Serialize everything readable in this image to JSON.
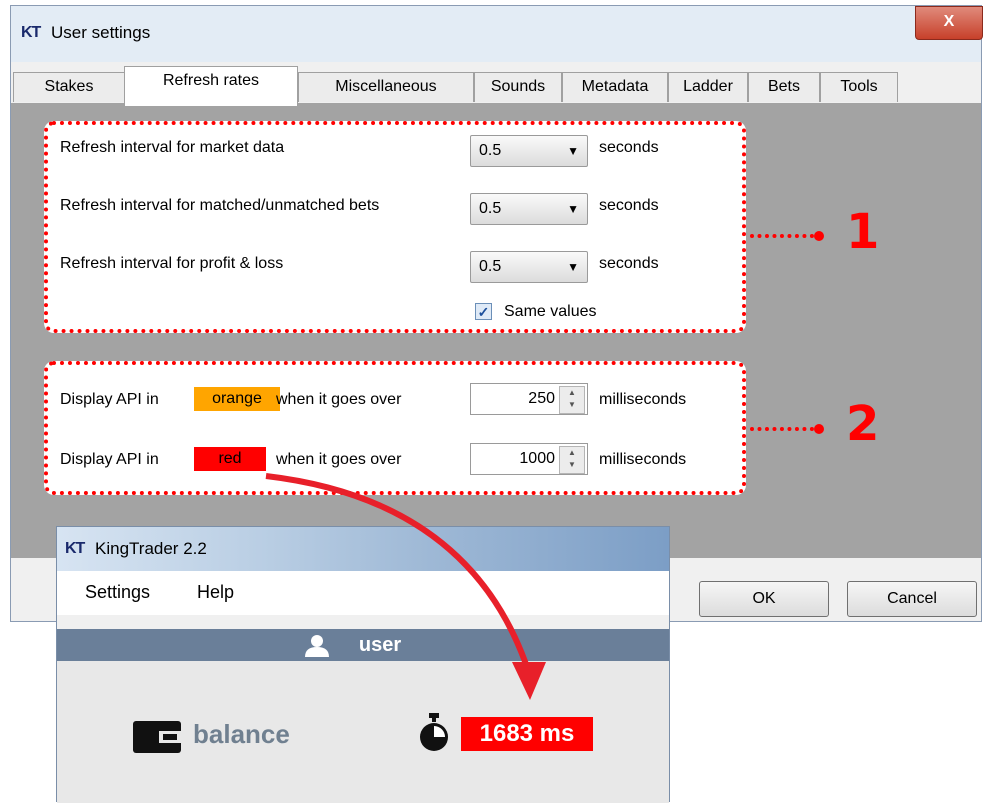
{
  "settings_window": {
    "logo": "KT",
    "title": "User settings",
    "close_label": "X",
    "tabs": [
      "Stakes",
      "Refresh rates",
      "Miscellaneous",
      "Sounds",
      "Metadata",
      "Ladder",
      "Bets",
      "Tools"
    ],
    "active_tab": "Refresh rates",
    "refresh_group": {
      "rows": [
        {
          "label": "Refresh interval for market data",
          "value": "0.5",
          "unit": "seconds"
        },
        {
          "label": "Refresh interval for matched/unmatched bets",
          "value": "0.5",
          "unit": "seconds"
        },
        {
          "label": "Refresh interval for profit & loss",
          "value": "0.5",
          "unit": "seconds"
        }
      ],
      "same_values_label": "Same values",
      "same_values_checked": true
    },
    "api_group": {
      "rows": [
        {
          "prefix": "Display API in",
          "color_name": "orange",
          "color": "#ffa500",
          "suffix": "when it goes over",
          "value": "250",
          "unit": "milliseconds"
        },
        {
          "prefix": "Display API in",
          "color_name": "red",
          "color": "#ff0000",
          "suffix": "when it goes over",
          "value": "1000",
          "unit": "milliseconds"
        }
      ]
    },
    "ok_label": "OK",
    "cancel_label": "Cancel"
  },
  "callouts": [
    "1",
    "2"
  ],
  "kingtrader": {
    "logo": "KT",
    "title": "KingTrader 2.2",
    "menu": [
      "Settings",
      "Help"
    ],
    "username": "user",
    "balance_label": "balance",
    "latency": "1683 ms"
  },
  "colors": {
    "annotation": "#ff0000",
    "user_bar": "#6a7f99",
    "latency_bg": "#ff0000"
  }
}
